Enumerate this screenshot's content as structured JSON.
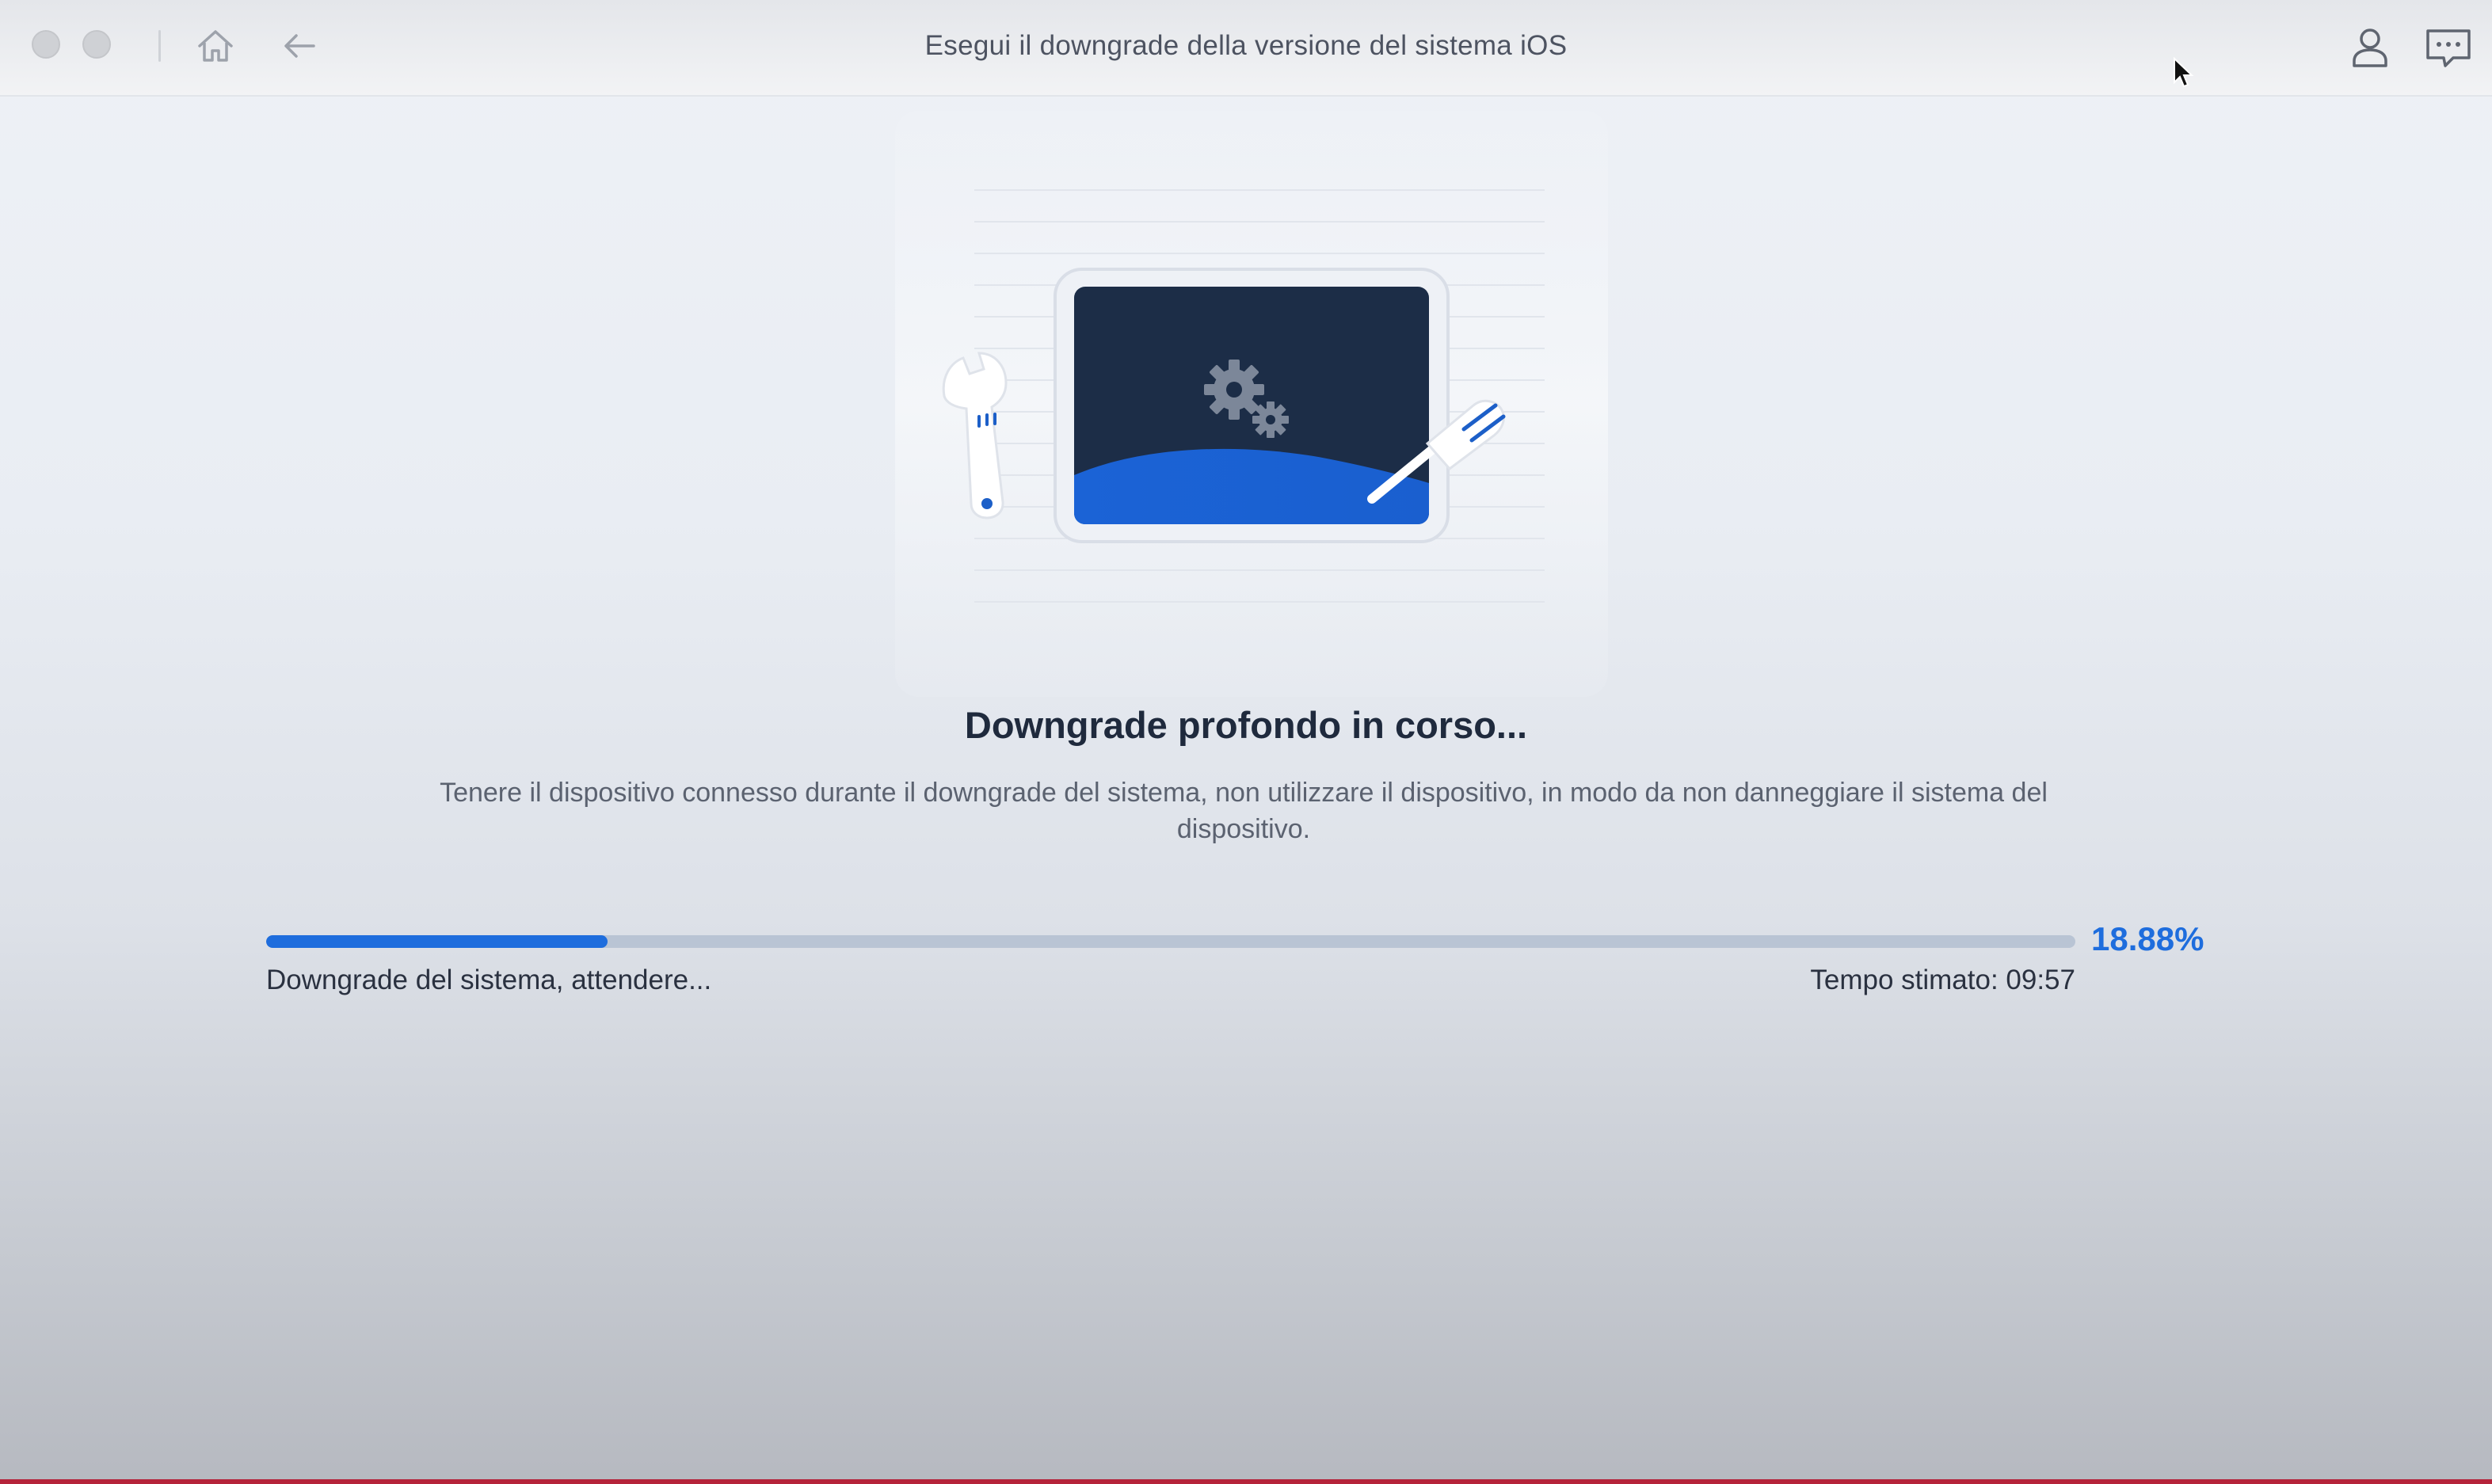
{
  "window": {
    "title": "Esegui il downgrade della versione del sistema iOS",
    "controls": [
      "close",
      "minimize"
    ],
    "toolbar_icons": [
      "home-icon",
      "back-arrow-icon",
      "account-icon",
      "feedback-icon"
    ]
  },
  "main": {
    "headline": "Downgrade profondo in corso...",
    "description": "Tenere il dispositivo connesso durante il downgrade del sistema, non utilizzare il dispositivo, in modo da non danneggiare il sistema del dispositivo.",
    "progress": {
      "percent_value": 18.88,
      "percent_label": "18.88%",
      "status": "Downgrade del sistema, attendere...",
      "eta_label": "Tempo stimato:",
      "eta_value": "09:57"
    }
  },
  "colors": {
    "accent": "#1e6ddd",
    "track": "#b9c4d4",
    "screen_dark": "#1c2d47",
    "headline": "#1f2a3d",
    "text": "#5b6270"
  },
  "illustration_icons": [
    "tablet-icon",
    "gears-icon",
    "wrench-icon",
    "screwdriver-icon"
  ]
}
